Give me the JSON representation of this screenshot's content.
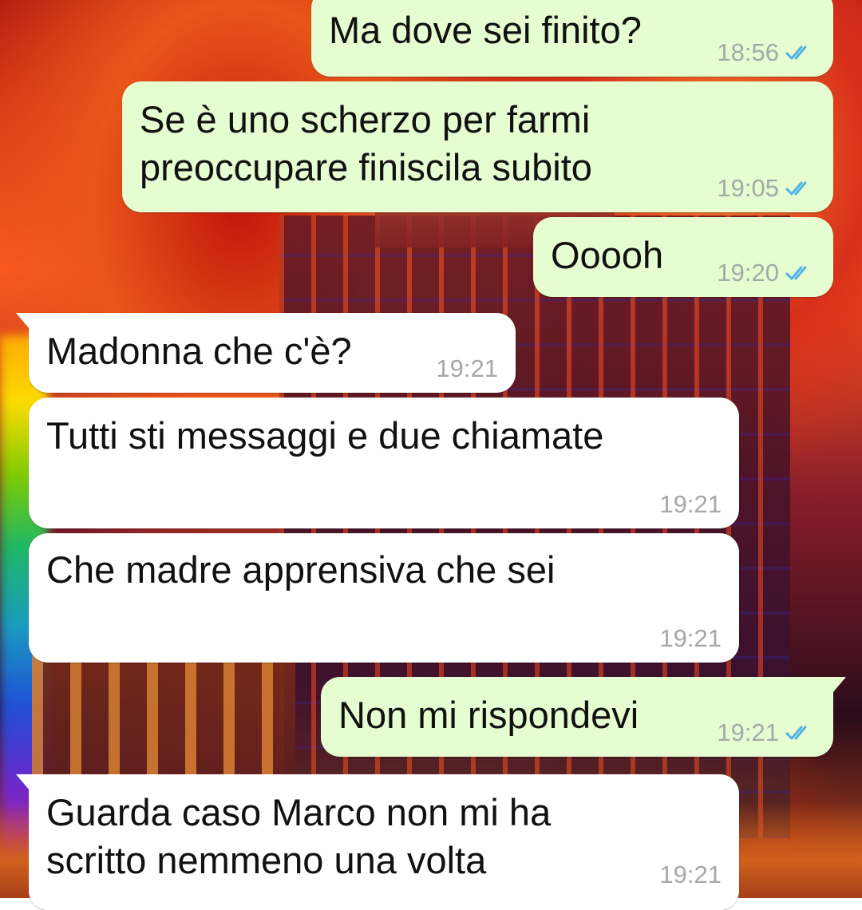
{
  "chat": {
    "messages": [
      {
        "id": "m1",
        "direction": "outgoing",
        "text": "Ma dove sei finito?",
        "time": "18:56",
        "read": true
      },
      {
        "id": "m2",
        "direction": "outgoing",
        "text": "Se è uno scherzo per farmi\npreoccupare finiscila subito",
        "time": "19:05",
        "read": true
      },
      {
        "id": "m3",
        "direction": "outgoing",
        "text": "Ooooh",
        "time": "19:20",
        "read": true
      },
      {
        "id": "m4",
        "direction": "incoming",
        "text": "Madonna che c'è?",
        "time": "19:21"
      },
      {
        "id": "m5",
        "direction": "incoming",
        "text": "Tutti sti messaggi e due chiamate",
        "time": "19:21"
      },
      {
        "id": "m6",
        "direction": "incoming",
        "text": "Che madre apprensiva che sei",
        "time": "19:21"
      },
      {
        "id": "m7",
        "direction": "outgoing",
        "text": "Non mi rispondevi",
        "time": "19:21",
        "read": true
      },
      {
        "id": "m8",
        "direction": "incoming",
        "text": "Guarda caso Marco non mi ha\nscritto nemmeno una volta",
        "time": "19:21"
      }
    ]
  },
  "icons": {
    "read_receipt": "double-check-icon"
  },
  "colors": {
    "outgoing_bubble": "#e5fdd0",
    "incoming_bubble": "#ffffff",
    "timestamp": "#a4a9a6",
    "read_tick": "#4fb2e8"
  }
}
